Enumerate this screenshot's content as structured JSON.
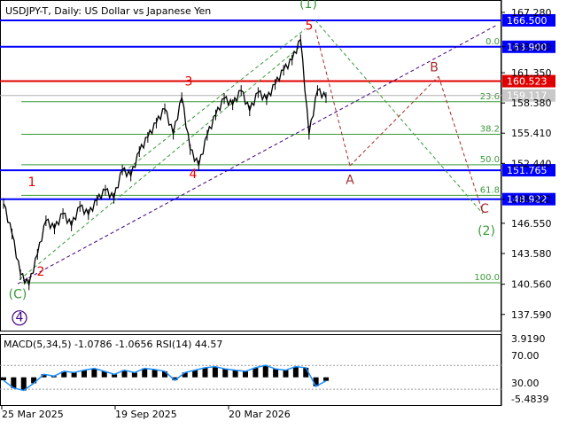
{
  "title": "USDJPY-T, Daily:  US Dollar vs Japanese Yen",
  "colors": {
    "blue": "#0000ff",
    "red": "#e00000",
    "green": "#3a9a3a",
    "darkred": "#a52a2a",
    "purple": "#400080",
    "candle": "#000000",
    "rsi": "#1e90ff"
  },
  "chart_data": {
    "type": "line",
    "symbol": "USDJPY-T",
    "timeframe": "Daily",
    "y_axis_ticks": [
      "167.280",
      "163.900",
      "161.350",
      "158.380",
      "155.410",
      "152.440",
      "148.922",
      "146.550",
      "143.580",
      "140.560",
      "137.590"
    ],
    "y_range": [
      136.0,
      168.5
    ],
    "x_axis_ticks": [
      "25 Mar 2025",
      "19 Sep 2025",
      "20 Mar 2026"
    ],
    "price_series": [
      148.5,
      145.5,
      141.5,
      140.5,
      143.5,
      146.8,
      146.0,
      147.5,
      146.3,
      148.2,
      147.4,
      148.8,
      149.8,
      149.0,
      151.8,
      151.2,
      153.6,
      155.0,
      156.4,
      157.8,
      155.3,
      158.9,
      153.8,
      152.2,
      155.2,
      157.2,
      158.8,
      158.2,
      159.6,
      157.6,
      159.4,
      158.7,
      160.2,
      161.6,
      162.6,
      164.6,
      155.3,
      159.6,
      158.9
    ],
    "price_levels": [
      {
        "value": 166.5,
        "label": "166.500",
        "color": "blue"
      },
      {
        "value": 163.9,
        "label": "163.900",
        "color": "blue"
      },
      {
        "value": 160.523,
        "label": "160.523",
        "color": "red"
      },
      {
        "value": 159.117,
        "label": "159.117",
        "color": "gray"
      },
      {
        "value": 151.765,
        "label": "151.765",
        "color": "blue"
      },
      {
        "value": 148.922,
        "label": "148.922",
        "color": "blue"
      }
    ],
    "fib_levels": [
      {
        "label": "0.0",
        "value": 163.9
      },
      {
        "label": "23.6",
        "value": 158.5
      },
      {
        "label": "38.2",
        "value": 155.3
      },
      {
        "label": "50.0",
        "value": 152.3
      },
      {
        "label": "61.8",
        "value": 149.3
      },
      {
        "label": "100.0",
        "value": 140.7
      }
    ],
    "wave_labels": [
      {
        "text": "(1)",
        "color": "green",
        "value": 167.7
      },
      {
        "text": "5",
        "color": "red",
        "value": 165.6
      },
      {
        "text": "3",
        "color": "red",
        "value": 160.1
      },
      {
        "text": "B",
        "color": "darkred",
        "value": 161.5
      },
      {
        "text": "1",
        "color": "red",
        "value": 150.2
      },
      {
        "text": "4",
        "color": "red",
        "value": 151.0
      },
      {
        "text": "A",
        "color": "darkred",
        "value": 150.4
      },
      {
        "text": "C",
        "color": "darkred",
        "value": 147.6
      },
      {
        "text": "(2)",
        "color": "green",
        "value": 145.4
      },
      {
        "text": "2",
        "color": "red",
        "value": 141.4
      },
      {
        "text": "(C)",
        "color": "green",
        "value": 139.2
      },
      {
        "text": "4",
        "color": "purple",
        "value": 136.9
      }
    ],
    "indicator": {
      "label": "MACD(5,34,5) -1.0786 -1.0656 RSI(14) 44.57",
      "y_ticks": [
        "3.9190",
        "70.00",
        "30.00",
        "-5.4839"
      ],
      "rsi_series": [
        45,
        32,
        28,
        40,
        55,
        52,
        60,
        58,
        62,
        65,
        60,
        55,
        62,
        58,
        65,
        63,
        60,
        45,
        58,
        62,
        66,
        68,
        64,
        62,
        60,
        66,
        70,
        64,
        62,
        68,
        66,
        35,
        44
      ]
    }
  }
}
